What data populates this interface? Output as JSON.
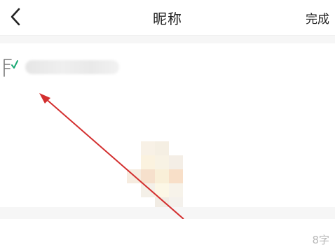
{
  "header": {
    "back_icon": "chevron-left-icon",
    "title": "昵称",
    "done_label": "完成"
  },
  "nickname": {
    "edit_icon": "edit-note-icon",
    "value": "",
    "char_count": "8字"
  },
  "avatar_mosaic": {
    "cells": [
      "#ffffff",
      "#f8f1e6",
      "#f5efe3",
      "#ffffff",
      "#ffffff",
      "#ffffff",
      "#fbf2df",
      "#f8f2e4",
      "#f4eee6",
      "#ffffff",
      "#f6ece0",
      "#f6e0cc",
      "#f9efd8",
      "#f8dfc8",
      "#ffffff",
      "#ffffff",
      "#f4f0e8",
      "#fcf7e6",
      "#f7f3ea",
      "#ffffff",
      "#ffffff",
      "#ffffff",
      "#f1ece4",
      "#f4f1ec",
      "#ffffff"
    ]
  },
  "colors": {
    "annotation_arrow": "#d32f2f",
    "check_accent": "#19a974"
  }
}
